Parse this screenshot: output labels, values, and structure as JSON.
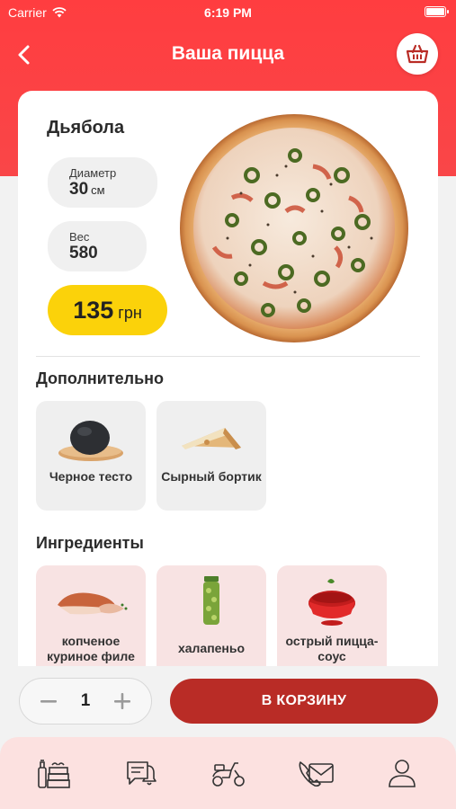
{
  "status_bar": {
    "carrier": "Carrier",
    "time": "6:19 PM"
  },
  "header": {
    "title": "Ваша пицца"
  },
  "product": {
    "name": "Дьябола",
    "diameter": {
      "label": "Диаметр",
      "value": "30",
      "unit": "см"
    },
    "weight": {
      "label": "Вес",
      "value": "580"
    },
    "price": {
      "value": "135",
      "currency": "грн"
    }
  },
  "extras": {
    "title": "Дополнительно",
    "items": [
      {
        "label": "Черное тесто",
        "icon": "black-dough-image"
      },
      {
        "label": "Сырный бортик",
        "icon": "cheese-crust-image"
      }
    ]
  },
  "ingredients": {
    "title": "Ингредиенты",
    "items": [
      {
        "label": "копченое куриное филе",
        "icon": "smoked-chicken-image"
      },
      {
        "label": "халапеньо",
        "icon": "jalapeno-jar-image"
      },
      {
        "label": "острый пицца-соус",
        "icon": "hot-sauce-image"
      }
    ]
  },
  "order": {
    "quantity": "1",
    "cart_button": "В КОРЗИНУ"
  },
  "tabbar": {
    "items": [
      {
        "name": "menu",
        "icon": "pizza-box-icon"
      },
      {
        "name": "news",
        "icon": "chat-bell-icon"
      },
      {
        "name": "delivery",
        "icon": "scooter-icon"
      },
      {
        "name": "contacts",
        "icon": "phone-mail-icon"
      },
      {
        "name": "profile",
        "icon": "profile-icon"
      }
    ]
  },
  "colors": {
    "accent": "#f94648",
    "button": "#b92c26",
    "price": "#fbd20a",
    "tabbar": "#fce1e0"
  }
}
